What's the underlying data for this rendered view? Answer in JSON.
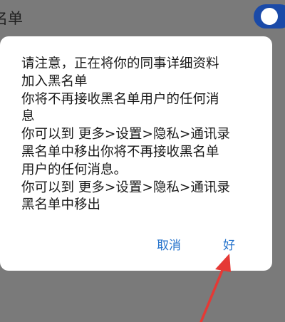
{
  "background": {
    "setting_label": "名单",
    "toggle_state": "on",
    "toggle_color": "#1a4aa8"
  },
  "dialog": {
    "message": "请注意，正在将你的同事详细资料\n加入黑名单\n你将不再接收黑名单用户的任何消\n息\n你可以到 更多>设置>隐私>通讯录\n黑名单中移出你将不再接收黑名单\n用户的任何消息。\n你可以到 更多>设置>隐私>通讯录\n黑名单中移出",
    "cancel_label": "取消",
    "ok_label": "好",
    "button_color": "#2573cc"
  },
  "annotation": {
    "arrow_color": "#e53935",
    "arrow_target": "ok-button"
  }
}
